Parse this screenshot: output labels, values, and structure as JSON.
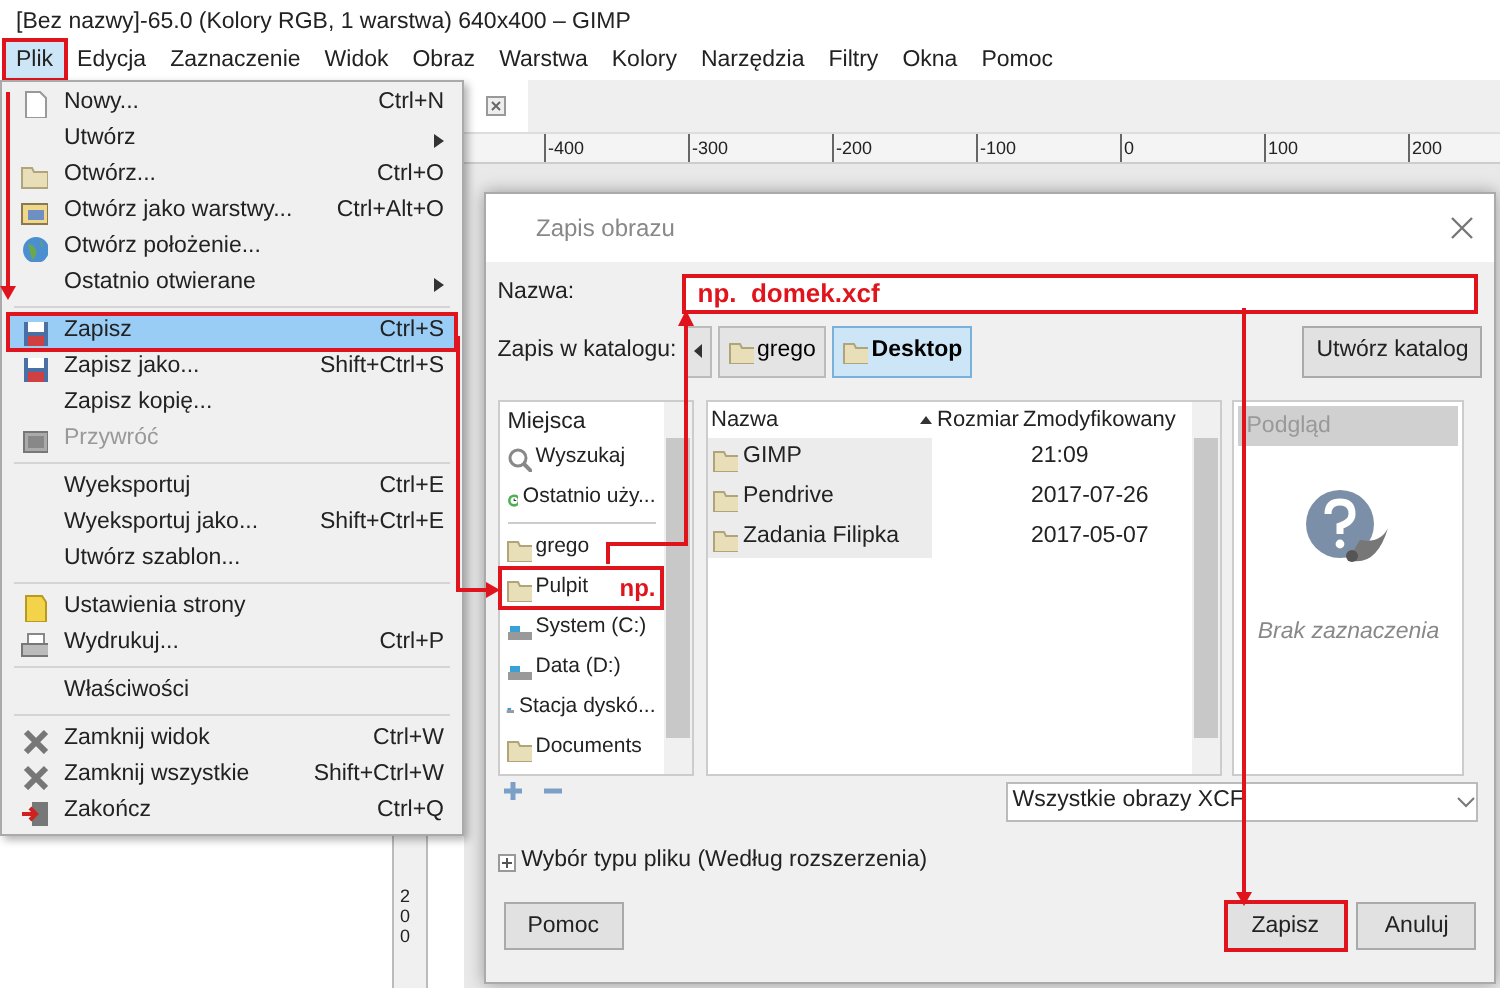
{
  "window": {
    "title": "[Bez nazwy]-65.0 (Kolory RGB, 1 warstwa) 640x400 – GIMP"
  },
  "menubar": [
    {
      "label": "Plik",
      "selected": true,
      "highlighted": true
    },
    {
      "label": "Edycja",
      "selected": false,
      "highlighted": false
    },
    {
      "label": "Zaznaczenie",
      "selected": false,
      "highlighted": false
    },
    {
      "label": "Widok",
      "selected": false,
      "highlighted": false
    },
    {
      "label": "Obraz",
      "selected": false,
      "highlighted": false
    },
    {
      "label": "Warstwa",
      "selected": false,
      "highlighted": false
    },
    {
      "label": "Kolory",
      "selected": false,
      "highlighted": false
    },
    {
      "label": "Narzędzia",
      "selected": false,
      "highlighted": false
    },
    {
      "label": "Filtry",
      "selected": false,
      "highlighted": false
    },
    {
      "label": "Okna",
      "selected": false,
      "highlighted": false
    },
    {
      "label": "Pomoc",
      "selected": false,
      "highlighted": false
    }
  ],
  "file_menu": [
    {
      "kind": "item",
      "label": "Nowy...",
      "shortcut": "Ctrl+N",
      "submenu": false,
      "disabled": false,
      "selected": false,
      "highlighted": false
    },
    {
      "kind": "item",
      "label": "Utwórz",
      "submenu": true,
      "disabled": false,
      "selected": false,
      "highlighted": false
    },
    {
      "kind": "item",
      "label": "Otwórz...",
      "shortcut": "Ctrl+O",
      "submenu": false,
      "disabled": false,
      "selected": false,
      "highlighted": false
    },
    {
      "kind": "item",
      "label": "Otwórz jako warstwy...",
      "shortcut": "Ctrl+Alt+O",
      "submenu": false,
      "disabled": false,
      "selected": false,
      "highlighted": false
    },
    {
      "kind": "item",
      "label": "Otwórz położenie...",
      "submenu": false,
      "disabled": false,
      "selected": false,
      "highlighted": false
    },
    {
      "kind": "item",
      "label": "Ostatnio otwierane",
      "submenu": true,
      "disabled": false,
      "selected": false,
      "highlighted": false
    },
    {
      "kind": "separator"
    },
    {
      "kind": "item",
      "label": "Zapisz",
      "shortcut": "Ctrl+S",
      "submenu": false,
      "disabled": false,
      "selected": true,
      "highlighted": true
    },
    {
      "kind": "item",
      "label": "Zapisz jako...",
      "shortcut": "Shift+Ctrl+S",
      "submenu": false,
      "disabled": false,
      "selected": false,
      "highlighted": false
    },
    {
      "kind": "item",
      "label": "Zapisz kopię...",
      "submenu": false,
      "disabled": false,
      "selected": false,
      "highlighted": false
    },
    {
      "kind": "item",
      "label": "Przywróć",
      "submenu": false,
      "disabled": true,
      "selected": false,
      "highlighted": false
    },
    {
      "kind": "separator"
    },
    {
      "kind": "item",
      "label": "Wyeksportuj",
      "shortcut": "Ctrl+E",
      "submenu": false,
      "disabled": false,
      "selected": false,
      "highlighted": false
    },
    {
      "kind": "item",
      "label": "Wyeksportuj jako...",
      "shortcut": "Shift+Ctrl+E",
      "submenu": false,
      "disabled": false,
      "selected": false,
      "highlighted": false
    },
    {
      "kind": "item",
      "label": "Utwórz szablon...",
      "submenu": false,
      "disabled": false,
      "selected": false,
      "highlighted": false
    },
    {
      "kind": "separator"
    },
    {
      "kind": "item",
      "label": "Ustawienia strony",
      "submenu": false,
      "disabled": false,
      "selected": false,
      "highlighted": false
    },
    {
      "kind": "item",
      "label": "Wydrukuj...",
      "shortcut": "Ctrl+P",
      "submenu": false,
      "disabled": false,
      "selected": false,
      "highlighted": false
    },
    {
      "kind": "separator"
    },
    {
      "kind": "item",
      "label": "Właściwości",
      "submenu": false,
      "disabled": false,
      "selected": false,
      "highlighted": false
    },
    {
      "kind": "separator"
    },
    {
      "kind": "item",
      "label": "Zamknij widok",
      "shortcut": "Ctrl+W",
      "submenu": false,
      "disabled": false,
      "selected": false,
      "highlighted": false
    },
    {
      "kind": "item",
      "label": "Zamknij wszystkie",
      "shortcut": "Shift+Ctrl+W",
      "submenu": false,
      "disabled": false,
      "selected": false,
      "highlighted": false
    },
    {
      "kind": "item",
      "label": "Zakończ",
      "shortcut": "Ctrl+Q",
      "submenu": false,
      "disabled": false,
      "selected": false,
      "highlighted": false
    }
  ],
  "ruler": {
    "labels": [
      "-400",
      "-300",
      "-200",
      "-100",
      "0",
      "100",
      "200"
    ],
    "vertical_label": "200"
  },
  "dialog": {
    "title": "Zapis obrazu",
    "name_label": "Nazwa:",
    "name_value": "np.  domek.xcf",
    "name_highlighted": true,
    "folder_label": "Zapis w katalogu:",
    "path": [
      {
        "label": "grego",
        "selected": false
      },
      {
        "label": "Desktop",
        "selected": true
      }
    ],
    "create_folder": "Utwórz katalog",
    "places_header": "Miejsca",
    "places": [
      {
        "kind": "item",
        "label": "Wyszukaj",
        "highlighted": false
      },
      {
        "kind": "item",
        "label": "Ostatnio uży...",
        "highlighted": false
      },
      {
        "kind": "separator"
      },
      {
        "kind": "item",
        "label": "grego",
        "highlighted": false
      },
      {
        "kind": "item",
        "label": "Pulpit",
        "note": "np.",
        "highlighted": true
      },
      {
        "kind": "item",
        "label": "System (C:)",
        "highlighted": false
      },
      {
        "kind": "item",
        "label": "Data (D:)",
        "highlighted": false
      },
      {
        "kind": "item",
        "label": "Stacja dyskó...",
        "highlighted": false
      },
      {
        "kind": "item",
        "label": "Documents",
        "highlighted": false
      }
    ],
    "columns": [
      "Nazwa",
      "Rozmiar",
      "Zmodyfikowany"
    ],
    "rows": [
      {
        "name": "GIMP",
        "modified": "21:09"
      },
      {
        "name": "Pendrive",
        "modified": "2017-07-26"
      },
      {
        "name": "Zadania Filipka",
        "modified": "2017-05-07"
      }
    ],
    "preview_header": "Podgląd",
    "preview_text": "Brak zaznaczenia",
    "filter": "Wszystkie obrazy XCF",
    "file_type": {
      "label": "Wybór typu pliku (Według rozszerzenia)",
      "expanded": false
    },
    "buttons": [
      {
        "label": "Pomoc",
        "highlighted": false
      },
      {
        "label": "Zapisz",
        "highlighted": true
      },
      {
        "label": "Anuluj",
        "highlighted": false
      }
    ]
  }
}
